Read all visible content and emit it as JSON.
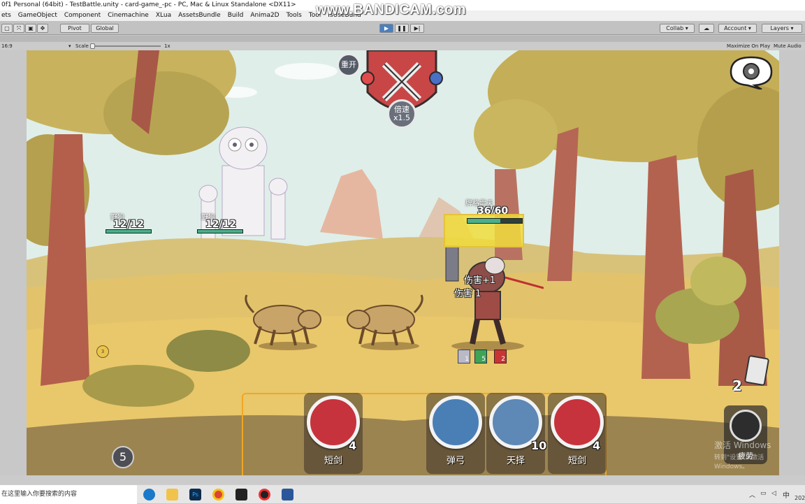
{
  "window": {
    "title": "0f1 Personal (64bit) - TestBattle.unity - card-game_-pc - PC, Mac & Linux Standalone <DX11>"
  },
  "menu": [
    "ets",
    "GameObject",
    "Component",
    "Cinemachine",
    "XLua",
    "AssetsBundle",
    "Build",
    "Anima2D",
    "Tools",
    "Tool",
    "IsUseBund"
  ],
  "toolbar": {
    "pivot": "Pivot",
    "global": "Global",
    "collab": "Collab",
    "account": "Account",
    "layers": "Layers"
  },
  "watermark": "www.BANDICAM.com",
  "gamebar": {
    "aspect": "16:9",
    "scale_label": "Scale",
    "scale_value": "1x",
    "maximize": "Maximize On Play",
    "mute": "Mute Audio"
  },
  "battle": {
    "restart_label": "重开",
    "speed_label": "倍速",
    "speed_value": "x1.5",
    "enemies": [
      {
        "name": "野狗",
        "hp": "12/12"
      },
      {
        "name": "野狗",
        "hp": "12/12"
      }
    ],
    "player": {
      "name": "牌格雷夫",
      "hp": "36/60"
    },
    "damage_texts": [
      "伤害+1",
      "伤害 1"
    ],
    "status_badges": [
      "1",
      "5",
      "2"
    ],
    "deck_count": "5",
    "discard_count": "2",
    "fatigue_label": "疲劳",
    "enemy_intent": "3",
    "activate_windows": [
      "激活 Windows",
      "转到\"设置\"以激活 Windows。"
    ]
  },
  "hand": [
    {
      "name": "短剑",
      "cost": "4",
      "icon": "burst-icon",
      "color": "#c7333c"
    },
    {
      "name": "弹弓",
      "cost": "",
      "icon": "slingshot-icon",
      "color": "#4a7fb5"
    },
    {
      "name": "天择",
      "cost": "10",
      "icon": "blank-orb-icon",
      "color": "#5e88b5"
    },
    {
      "name": "短剑",
      "cost": "4",
      "icon": "burst-icon",
      "color": "#c7333c"
    }
  ],
  "taskbar": {
    "search_placeholder": "在这里输入你要搜索的内容",
    "ime": "中",
    "year": "202"
  }
}
